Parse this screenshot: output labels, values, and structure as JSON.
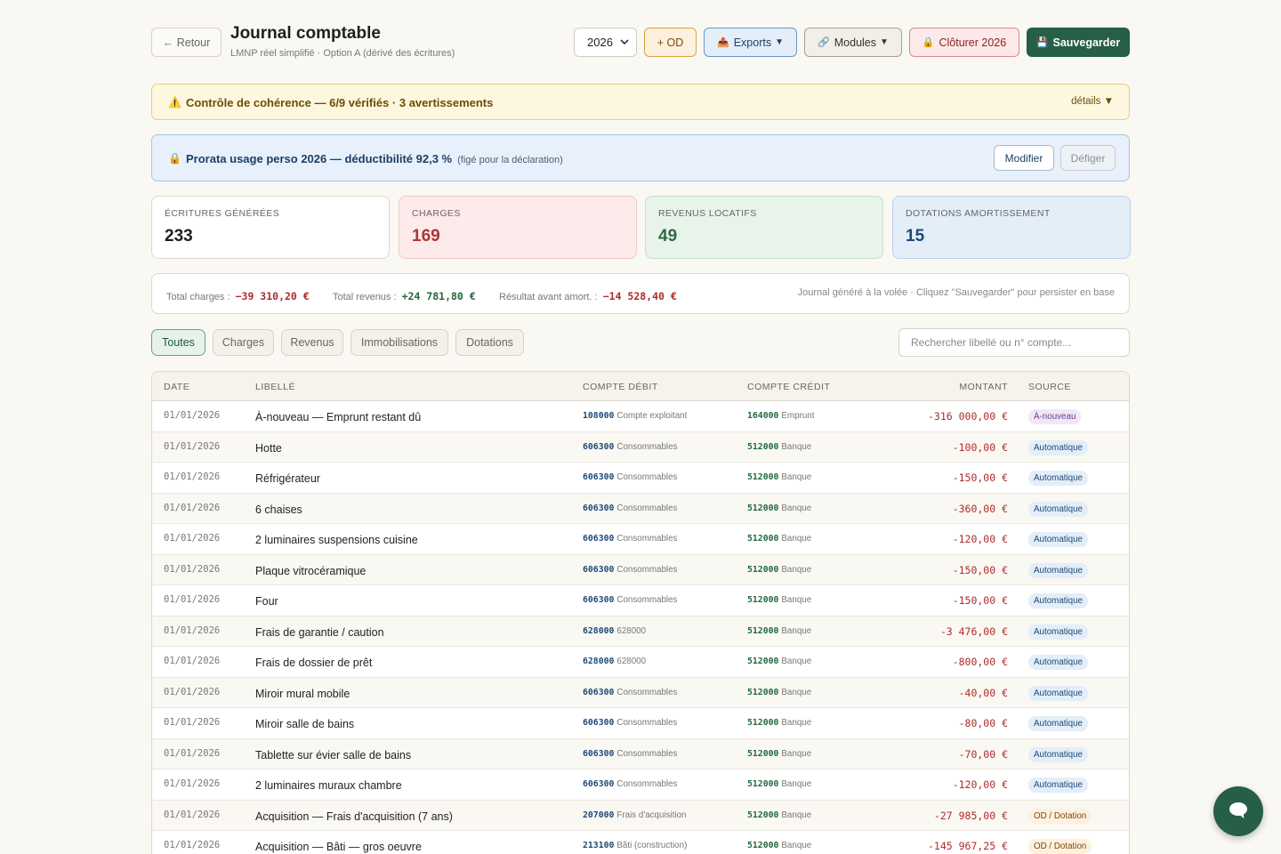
{
  "header": {
    "back_label": "← Retour",
    "title": "Journal comptable",
    "subtitle": "LMNP réel simplifié · Option A (dérivé des écritures)",
    "year": "2026",
    "od_label": "+ OD",
    "exports_label": "Exports",
    "modules_label": "Modules",
    "close_label": "Clôturer 2026",
    "save_label": "Sauvegarder"
  },
  "alert": {
    "text": "Contrôle de cohérence — 6/9 vérifiés · 3 avertissements",
    "details": "détails"
  },
  "prorata": {
    "text": "Prorata usage perso 2026 — déductibilité 92,3 %",
    "note": "(figé pour la déclaration)",
    "modify": "Modifier",
    "unfreeze": "Défiger"
  },
  "stats": [
    {
      "label": "ÉCRITURES GÉNÉRÉES",
      "value": "233"
    },
    {
      "label": "CHARGES",
      "value": "169"
    },
    {
      "label": "REVENUS LOCATIFS",
      "value": "49"
    },
    {
      "label": "DOTATIONS AMORTISSEMENT",
      "value": "15"
    }
  ],
  "totals": {
    "charges_label": "Total charges :",
    "charges_value": "−39 310,20 €",
    "revenus_label": "Total revenus :",
    "revenus_value": "+24 781,80 €",
    "resultat_label": "Résultat avant amort. :",
    "resultat_value": "−14 528,40 €",
    "hint": "Journal généré à la volée · Cliquez \"Sauvegarder\" pour persister en base"
  },
  "filters": [
    "Toutes",
    "Charges",
    "Revenus",
    "Immobilisations",
    "Dotations"
  ],
  "search_placeholder": "Rechercher libellé ou n° compte...",
  "columns": [
    "DATE",
    "LIBELLÉ",
    "COMPTE DÉBIT",
    "COMPTE CRÉDIT",
    "MONTANT",
    "SOURCE"
  ],
  "rows": [
    {
      "date": "01/01/2026",
      "libelle": "À-nouveau — Emprunt restant dû",
      "debit": "108000",
      "debit_name": "Compte exploitant",
      "credit": "164000",
      "credit_name": "Emprunt",
      "amount": "-316 000,00 €",
      "source": "À-nouveau",
      "kind": "an"
    },
    {
      "date": "01/01/2026",
      "libelle": "Hotte",
      "debit": "606300",
      "debit_name": "Consommables",
      "credit": "512000",
      "credit_name": "Banque",
      "amount": "-100,00 €",
      "source": "Automatique",
      "kind": "auto"
    },
    {
      "date": "01/01/2026",
      "libelle": "Réfrigérateur",
      "debit": "606300",
      "debit_name": "Consommables",
      "credit": "512000",
      "credit_name": "Banque",
      "amount": "-150,00 €",
      "source": "Automatique",
      "kind": "auto"
    },
    {
      "date": "01/01/2026",
      "libelle": "6 chaises",
      "debit": "606300",
      "debit_name": "Consommables",
      "credit": "512000",
      "credit_name": "Banque",
      "amount": "-360,00 €",
      "source": "Automatique",
      "kind": "auto"
    },
    {
      "date": "01/01/2026",
      "libelle": "2 luminaires suspensions cuisine",
      "debit": "606300",
      "debit_name": "Consommables",
      "credit": "512000",
      "credit_name": "Banque",
      "amount": "-120,00 €",
      "source": "Automatique",
      "kind": "auto"
    },
    {
      "date": "01/01/2026",
      "libelle": "Plaque vitrocéramique",
      "debit": "606300",
      "debit_name": "Consommables",
      "credit": "512000",
      "credit_name": "Banque",
      "amount": "-150,00 €",
      "source": "Automatique",
      "kind": "auto"
    },
    {
      "date": "01/01/2026",
      "libelle": "Four",
      "debit": "606300",
      "debit_name": "Consommables",
      "credit": "512000",
      "credit_name": "Banque",
      "amount": "-150,00 €",
      "source": "Automatique",
      "kind": "auto"
    },
    {
      "date": "01/01/2026",
      "libelle": "Frais de garantie / caution",
      "debit": "628000",
      "debit_name": "628000",
      "credit": "512000",
      "credit_name": "Banque",
      "amount": "-3 476,00 €",
      "source": "Automatique",
      "kind": "auto"
    },
    {
      "date": "01/01/2026",
      "libelle": "Frais de dossier de prêt",
      "debit": "628000",
      "debit_name": "628000",
      "credit": "512000",
      "credit_name": "Banque",
      "amount": "-800,00 €",
      "source": "Automatique",
      "kind": "auto"
    },
    {
      "date": "01/01/2026",
      "libelle": "Miroir mural mobile",
      "debit": "606300",
      "debit_name": "Consommables",
      "credit": "512000",
      "credit_name": "Banque",
      "amount": "-40,00 €",
      "source": "Automatique",
      "kind": "auto"
    },
    {
      "date": "01/01/2026",
      "libelle": "Miroir salle de bains",
      "debit": "606300",
      "debit_name": "Consommables",
      "credit": "512000",
      "credit_name": "Banque",
      "amount": "-80,00 €",
      "source": "Automatique",
      "kind": "auto"
    },
    {
      "date": "01/01/2026",
      "libelle": "Tablette sur évier salle de bains",
      "debit": "606300",
      "debit_name": "Consommables",
      "credit": "512000",
      "credit_name": "Banque",
      "amount": "-70,00 €",
      "source": "Automatique",
      "kind": "auto"
    },
    {
      "date": "01/01/2026",
      "libelle": "2 luminaires muraux chambre",
      "debit": "606300",
      "debit_name": "Consommables",
      "credit": "512000",
      "credit_name": "Banque",
      "amount": "-120,00 €",
      "source": "Automatique",
      "kind": "auto"
    },
    {
      "date": "01/01/2026",
      "libelle": "Acquisition — Frais d'acquisition (7 ans)",
      "debit": "207000",
      "debit_name": "Frais d'acquisition",
      "credit": "512000",
      "credit_name": "Banque",
      "amount": "-27 985,00 €",
      "source": "OD / Dotation",
      "kind": "od"
    },
    {
      "date": "01/01/2026",
      "libelle": "Acquisition — Bâti — gros oeuvre",
      "debit": "213100",
      "debit_name": "Bâti (construction)",
      "credit": "512000",
      "credit_name": "Banque",
      "amount": "-145 967,25 €",
      "source": "OD / Dotation",
      "kind": "od"
    }
  ]
}
